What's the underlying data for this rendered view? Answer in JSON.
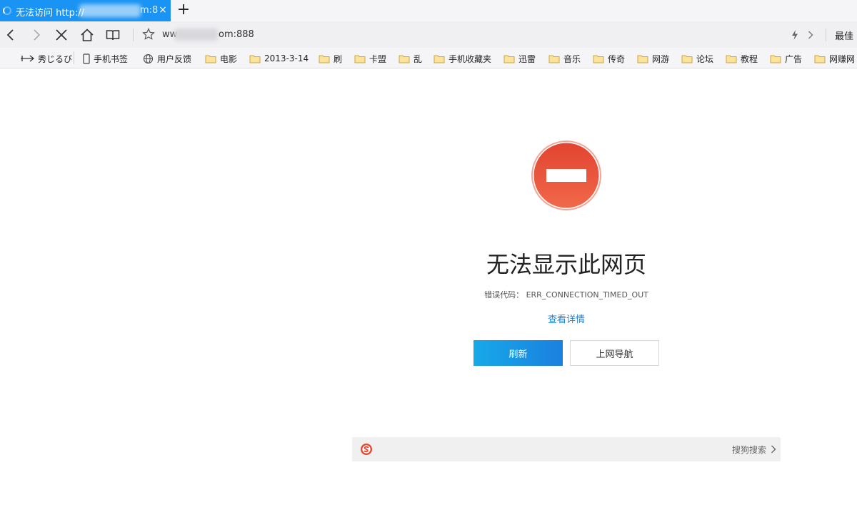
{
  "tab": {
    "title": "无法访问 http://",
    "url_suffix": "m:8",
    "close_symbol": "×",
    "new_tab_symbol": "+"
  },
  "address_bar": {
    "url_prefix": "ww",
    "url_suffix": "om:888"
  },
  "toolbar": {
    "best_view_label": "最佳"
  },
  "bookmarks": [
    {
      "label": "秀じるび",
      "icon": "scissors-icon"
    },
    {
      "label": "手机书签",
      "icon": "phone-icon"
    },
    {
      "label": "用户反馈",
      "icon": "globe-icon"
    },
    {
      "label": "电影",
      "icon": "folder-icon"
    },
    {
      "label": "2013-3-14",
      "icon": "folder-icon"
    },
    {
      "label": "刷",
      "icon": "folder-icon"
    },
    {
      "label": "卡盟",
      "icon": "folder-icon"
    },
    {
      "label": "乱",
      "icon": "folder-icon"
    },
    {
      "label": "手机收藏夹",
      "icon": "folder-icon"
    },
    {
      "label": "迅雷",
      "icon": "folder-icon"
    },
    {
      "label": "音乐",
      "icon": "folder-icon"
    },
    {
      "label": "传奇",
      "icon": "folder-icon"
    },
    {
      "label": "网游",
      "icon": "folder-icon"
    },
    {
      "label": "论坛",
      "icon": "folder-icon"
    },
    {
      "label": "教程",
      "icon": "folder-icon"
    },
    {
      "label": "广告",
      "icon": "folder-icon"
    },
    {
      "label": "网赚网",
      "icon": "folder-icon"
    }
  ],
  "error": {
    "title": "无法显示此网页",
    "code_label": "错误代码：",
    "code_value": "ERR_CONNECTION_TIMED_OUT",
    "details_link": "查看详情",
    "refresh_button": "刷新",
    "nav_button": "上网导航"
  },
  "search": {
    "label": "搜狗搜索",
    "brand_color": "#e9462f"
  },
  "colors": {
    "tab_active": "#1a94f4",
    "accent_blue": "#1a80e0",
    "error_red": "#e04a35",
    "link_blue": "#1a7fd6"
  }
}
